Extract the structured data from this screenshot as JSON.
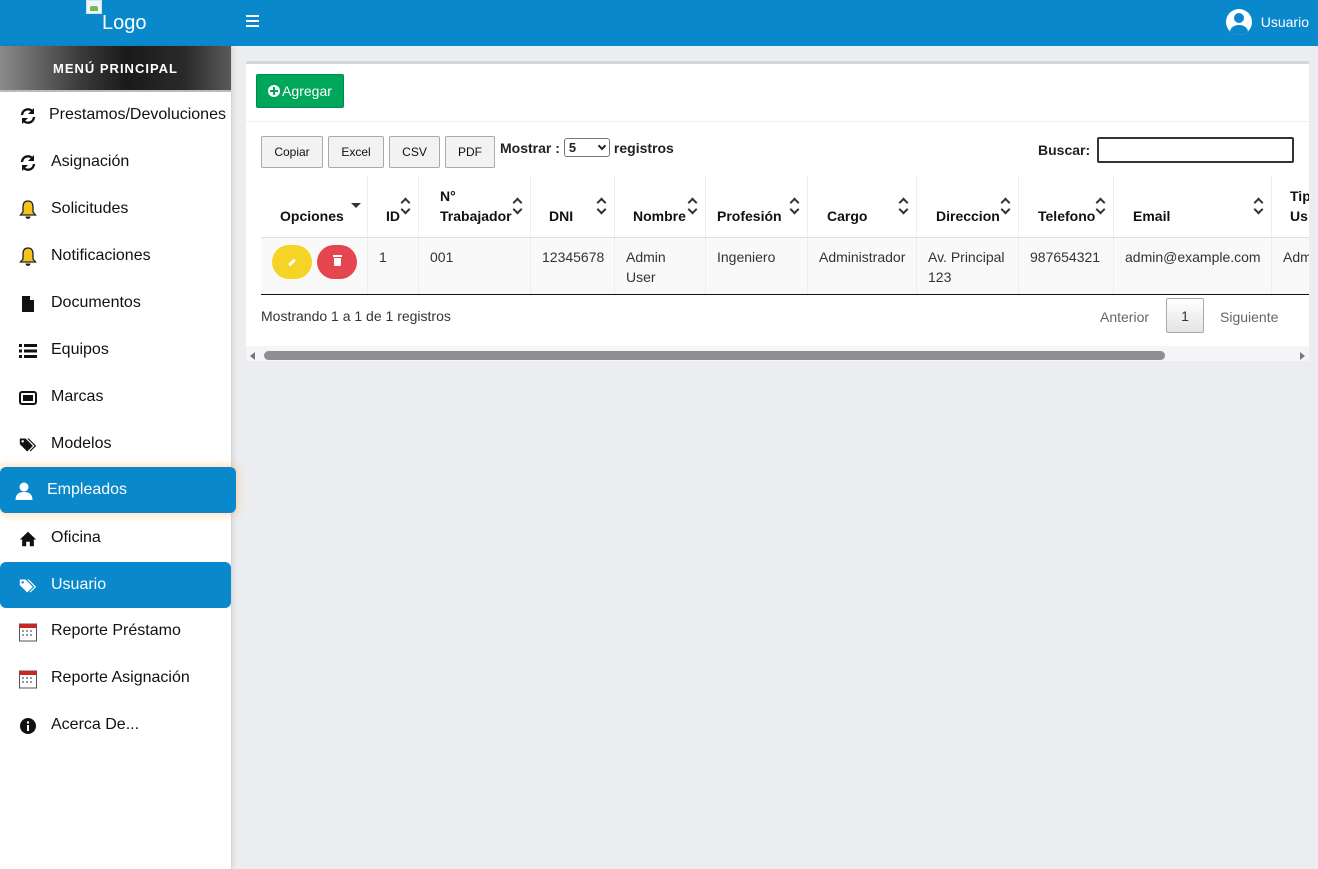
{
  "topbar": {
    "logo_alt": "Logo",
    "user_label": "Usuario"
  },
  "sidebar": {
    "header": "MENÚ PRINCIPAL",
    "items": [
      {
        "label": "Prestamos/Devoluciones",
        "icon": "refresh-icon"
      },
      {
        "label": "Asignación",
        "icon": "refresh-icon"
      },
      {
        "label": "Solicitudes",
        "icon": "bell-icon"
      },
      {
        "label": "Notificaciones",
        "icon": "bell-icon"
      },
      {
        "label": "Documentos",
        "icon": "file-icon"
      },
      {
        "label": "Equipos",
        "icon": "list-icon"
      },
      {
        "label": "Marcas",
        "icon": "tv-icon"
      },
      {
        "label": "Modelos",
        "icon": "tags-icon"
      },
      {
        "label": "Empleados",
        "icon": "user-icon"
      },
      {
        "label": "Oficina",
        "icon": "home-icon"
      },
      {
        "label": "Usuario",
        "icon": "tags-icon"
      },
      {
        "label": "Reporte Préstamo",
        "icon": "calendar-icon"
      },
      {
        "label": "Reporte Asignación",
        "icon": "calendar-icon"
      },
      {
        "label": "Acerca De...",
        "icon": "info-icon"
      }
    ]
  },
  "main": {
    "add_label": "Agregar",
    "export_buttons": [
      "Copiar",
      "Excel",
      "CSV",
      "PDF"
    ],
    "show_prefix": "Mostrar :",
    "show_value": "5",
    "show_suffix": "registros",
    "search_label": "Buscar:",
    "search_value": "",
    "columns": [
      "Opciones",
      "ID",
      "N° Trabajador",
      "DNI",
      "Nombre",
      "Profesión",
      "Cargo",
      "Direccion",
      "Telefono",
      "Email",
      "Tipo Us"
    ],
    "rows": [
      {
        "id": "1",
        "trabajador": "001",
        "dni": "12345678",
        "nombre": "Admin User",
        "profesion": "Ingeniero",
        "cargo": "Administrador",
        "direccion": "Av. Principal 123",
        "telefono": "987654321",
        "email": "admin@example.com",
        "tipo": "Adm"
      }
    ],
    "info_text": "Mostrando 1 a 1 de 1 registros",
    "pagination": {
      "prev": "Anterior",
      "current": "1",
      "next": "Siguiente"
    }
  },
  "colors": {
    "topbar": "#0a88cc",
    "active_menu": "#0a88cc",
    "add_button": "#00a65a",
    "edit_button": "#f5d426",
    "delete_button": "#e5454f"
  }
}
